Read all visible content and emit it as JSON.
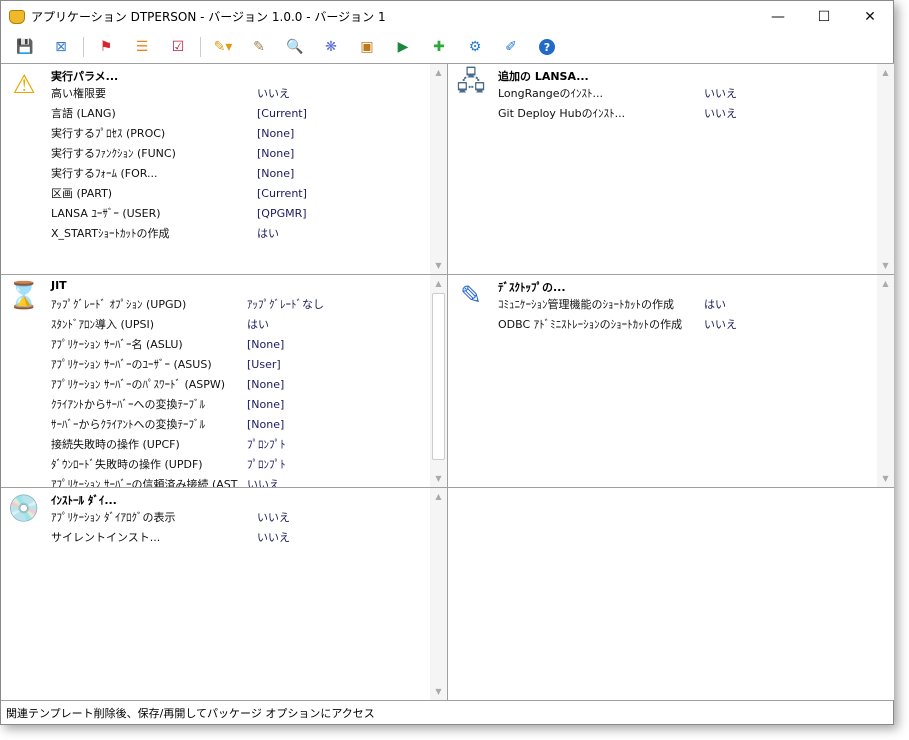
{
  "window": {
    "title": "アプリケーション DTPERSON - バージョン 1.0.0 - バージョン 1",
    "minimize": "—",
    "maximize": "☐",
    "close": "✕"
  },
  "toolbar": [
    {
      "name": "save-icon",
      "glyph": "💾",
      "color": "#1f4f9a"
    },
    {
      "name": "close-package-icon",
      "glyph": "⊠",
      "color": "#3a7bd5"
    },
    {
      "name": "flag-icon",
      "glyph": "⚑",
      "color": "#d9232d"
    },
    {
      "name": "list-icon",
      "glyph": "☰",
      "color": "#f0821e"
    },
    {
      "name": "checklist-icon",
      "glyph": "☑",
      "color": "#c0183c"
    },
    {
      "name": "edit-pencil-icon",
      "glyph": "✎▾",
      "color": "#e09a18"
    },
    {
      "name": "edit-document-icon",
      "glyph": "✎",
      "color": "#a08050"
    },
    {
      "name": "folder-search-icon",
      "glyph": "🔍",
      "color": "#e8a010"
    },
    {
      "name": "component-icon",
      "glyph": "❋",
      "color": "#5a6ad8"
    },
    {
      "name": "image-icon",
      "glyph": "▣",
      "color": "#c07818"
    },
    {
      "name": "play-icon",
      "glyph": "▶",
      "color": "#1a8a3a"
    },
    {
      "name": "add-document-icon",
      "glyph": "✚",
      "color": "#2aaa3a"
    },
    {
      "name": "settings-gear-icon",
      "glyph": "⚙",
      "color": "#2a7ad5"
    },
    {
      "name": "edit-window-icon",
      "glyph": "✐",
      "color": "#2a7ad5"
    },
    {
      "name": "help-icon",
      "glyph": "?",
      "color": "#1f6bc7"
    }
  ],
  "panels": {
    "exec": {
      "title": "実行パラメ...",
      "icon": "⚠",
      "rows": [
        {
          "label": "高い権限要",
          "value": "いいえ"
        },
        {
          "label": "言語 (LANG)",
          "value": "[Current]"
        },
        {
          "label": "実行するﾌﾟﾛｾｽ (PROC)",
          "value": "[None]"
        },
        {
          "label": "実行するﾌｧﾝｸｼｮﾝ (FUNC)",
          "value": "[None]"
        },
        {
          "label": "実行するﾌｫｰﾑ (FOR...",
          "value": "[None]"
        },
        {
          "label": "区画 (PART)",
          "value": "[Current]"
        },
        {
          "label": "LANSA ﾕｰｻﾞｰ (USER)",
          "value": "[QPGMR]"
        },
        {
          "label": "X_STARTｼｮｰﾄｶｯﾄの作成",
          "value": "はい"
        }
      ]
    },
    "lansa": {
      "title": "追加の LANSA...",
      "icon": "🖧",
      "rows": [
        {
          "label": "LongRangeのｲﾝｽﾄ...",
          "value": "いいえ"
        },
        {
          "label": "Git Deploy Hubのｲﾝｽﾄ...",
          "value": "いいえ"
        }
      ]
    },
    "jit": {
      "title": "JIT",
      "icon": "⌛",
      "rows": [
        {
          "label": "ｱｯﾌﾟｸﾞﾚｰﾄﾞ ｵﾌﾟｼｮﾝ (UPGD)",
          "value": "ｱｯﾌﾟｸﾞﾚｰﾄﾞなし"
        },
        {
          "label": "ｽﾀﾝﾄﾞｱﾛﾝ導入 (UPSI)",
          "value": "はい"
        },
        {
          "label": "ｱﾌﾟﾘｹｰｼｮﾝ ｻｰﾊﾞｰ名 (ASLU)",
          "value": "[None]"
        },
        {
          "label": "ｱﾌﾟﾘｹｰｼｮﾝ ｻｰﾊﾞｰのﾕｰｻﾞｰ (ASUS)",
          "value": "[User]"
        },
        {
          "label": "ｱﾌﾟﾘｹｰｼｮﾝ ｻｰﾊﾞｰのﾊﾟｽﾜｰﾄﾞ (ASPW)",
          "value": "[None]"
        },
        {
          "label": "ｸﾗｲｱﾝﾄからｻｰﾊﾞｰへの変換ﾃｰﾌﾞﾙ",
          "value": "[None]"
        },
        {
          "label": "ｻｰﾊﾞｰからｸﾗｲｱﾝﾄへの変換ﾃｰﾌﾞﾙ",
          "value": "[None]"
        },
        {
          "label": "接続失敗時の操作 (UPCF)",
          "value": "ﾌﾟﾛﾝﾌﾟﾄ"
        },
        {
          "label": "ﾀﾞｳﾝﾛｰﾄﾞ失敗時の操作 (UPDF)",
          "value": "ﾌﾟﾛﾝﾌﾟﾄ"
        },
        {
          "label": "ｱﾌﾟﾘｹｰｼｮﾝ ｻｰﾊﾞｰの信頼済み接続 (AST",
          "value": "いいえ"
        }
      ]
    },
    "desktop": {
      "title": "ﾃﾞｽｸﾄｯﾌﾟの...",
      "icon": "✎",
      "rows": [
        {
          "label": "ｺﾐｭﾆｹｰｼｮﾝ管理機能のｼｮｰﾄｶｯﾄの作成",
          "value": "はい"
        },
        {
          "label": "ODBC ｱﾄﾞﾐﾆｽﾄﾚｰｼｮﾝのｼｮｰﾄｶｯﾄの作成",
          "value": "いいえ"
        }
      ]
    },
    "install": {
      "title": "ｲﾝｽﾄｰﾙ ﾀﾞｲ...",
      "icon": "💿",
      "rows": [
        {
          "label": "ｱﾌﾟﾘｹｰｼｮﾝ ﾀﾞｲｱﾛｸﾞの表示",
          "value": "いいえ"
        },
        {
          "label": "サイレントインスト...",
          "value": "いいえ"
        }
      ]
    }
  },
  "status": "関連テンプレート削除後、保存/再開してパッケージ オプションにアクセス"
}
